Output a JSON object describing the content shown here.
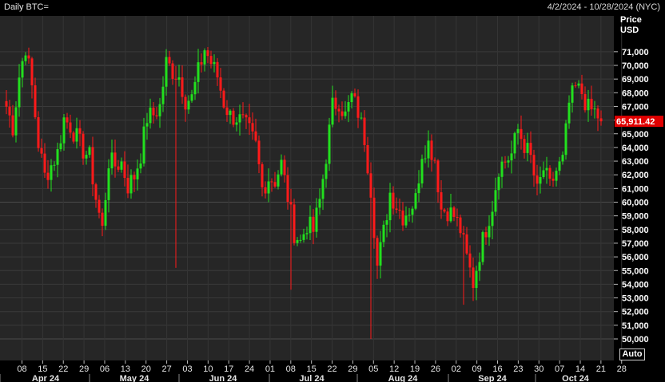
{
  "header": {
    "instrument": "Daily BTC=",
    "range": "4/2/2024 - 10/28/2024 (NYC)"
  },
  "axis_panel": {
    "price_title": "Price",
    "currency": "USD",
    "auto_label": "Auto"
  },
  "chart_data": {
    "type": "candlestick",
    "title": "Daily BTC=",
    "subtitle": "4/2/2024 - 10/28/2024 (NYC)",
    "ylabel": "Price USD",
    "ylim": [
      48900,
      73300
    ],
    "y_ticks": [
      50000,
      51000,
      52000,
      53000,
      54000,
      55000,
      56000,
      57000,
      58000,
      59000,
      60000,
      61000,
      62000,
      63000,
      64000,
      65000,
      66000,
      67000,
      68000,
      69000,
      70000,
      71000
    ],
    "y_major_ticks": [
      50000,
      60000,
      70000
    ],
    "x_tick_labels": [
      "08",
      "15",
      "22",
      "29",
      "06",
      "13",
      "20",
      "27",
      "03",
      "10",
      "17",
      "24",
      "01",
      "08",
      "15",
      "22",
      "29",
      "05",
      "12",
      "19",
      "26",
      "02",
      "09",
      "16",
      "23",
      "30",
      "07",
      "14",
      "21",
      "28"
    ],
    "month_labels": [
      "Apr 24",
      "May 24",
      "Jun 24",
      "Jul 24",
      "Aug 24",
      "Sep 24",
      "Oct 24"
    ],
    "last_price": 65911.42,
    "last_price_label": "65,911.42",
    "up_color": "#22e01e",
    "down_color": "#ff1a1a",
    "grid": true,
    "close_path": [
      [
        0,
        67000
      ],
      [
        2,
        65500
      ],
      [
        4,
        69200
      ],
      [
        6,
        71400
      ],
      [
        8,
        68400
      ],
      [
        10,
        64300
      ],
      [
        12,
        61900
      ],
      [
        14,
        62700
      ],
      [
        16,
        63600
      ],
      [
        18,
        66100
      ],
      [
        20,
        65600
      ],
      [
        22,
        64700
      ],
      [
        24,
        63800
      ],
      [
        26,
        63300
      ],
      [
        28,
        60300
      ],
      [
        30,
        58000
      ],
      [
        32,
        63000
      ],
      [
        34,
        62700
      ],
      [
        36,
        62900
      ],
      [
        38,
        61200
      ],
      [
        40,
        61900
      ],
      [
        42,
        63500
      ],
      [
        44,
        66200
      ],
      [
        46,
        66400
      ],
      [
        48,
        67000
      ],
      [
        50,
        70200
      ],
      [
        52,
        69600
      ],
      [
        54,
        69200
      ],
      [
        56,
        67500
      ],
      [
        58,
        67600
      ],
      [
        60,
        69500
      ],
      [
        62,
        71200
      ],
      [
        64,
        70200
      ],
      [
        66,
        69200
      ],
      [
        68,
        67300
      ],
      [
        70,
        66300
      ],
      [
        72,
        66200
      ],
      [
        74,
        65800
      ],
      [
        76,
        65100
      ],
      [
        78,
        64100
      ],
      [
        80,
        61000
      ],
      [
        82,
        61800
      ],
      [
        84,
        61600
      ],
      [
        86,
        62800
      ],
      [
        88,
        60400
      ],
      [
        90,
        57800
      ],
      [
        92,
        57100
      ],
      [
        94,
        58400
      ],
      [
        96,
        57900
      ],
      [
        98,
        60100
      ],
      [
        100,
        63400
      ],
      [
        102,
        67000
      ],
      [
        104,
        67400
      ],
      [
        106,
        66300
      ],
      [
        108,
        67700
      ],
      [
        110,
        66600
      ],
      [
        112,
        64700
      ],
      [
        114,
        61000
      ],
      [
        116,
        55300
      ],
      [
        118,
        57800
      ],
      [
        120,
        60700
      ],
      [
        122,
        59800
      ],
      [
        124,
        59000
      ],
      [
        126,
        59500
      ],
      [
        128,
        60200
      ],
      [
        130,
        63700
      ],
      [
        132,
        64300
      ],
      [
        134,
        63200
      ],
      [
        136,
        59500
      ],
      [
        138,
        59400
      ],
      [
        140,
        59000
      ],
      [
        142,
        58000
      ],
      [
        144,
        55900
      ],
      [
        146,
        54100
      ],
      [
        148,
        56300
      ],
      [
        150,
        58100
      ],
      [
        152,
        59800
      ],
      [
        154,
        62600
      ],
      [
        156,
        63000
      ],
      [
        158,
        63500
      ],
      [
        160,
        65300
      ],
      [
        162,
        64200
      ],
      [
        164,
        63200
      ],
      [
        166,
        60700
      ],
      [
        168,
        62400
      ],
      [
        170,
        61100
      ],
      [
        172,
        62300
      ],
      [
        174,
        63000
      ],
      [
        176,
        67200
      ],
      [
        178,
        68300
      ],
      [
        180,
        68000
      ],
      [
        182,
        66800
      ],
      [
        184,
        66600
      ],
      [
        186,
        66000
      ]
    ]
  }
}
